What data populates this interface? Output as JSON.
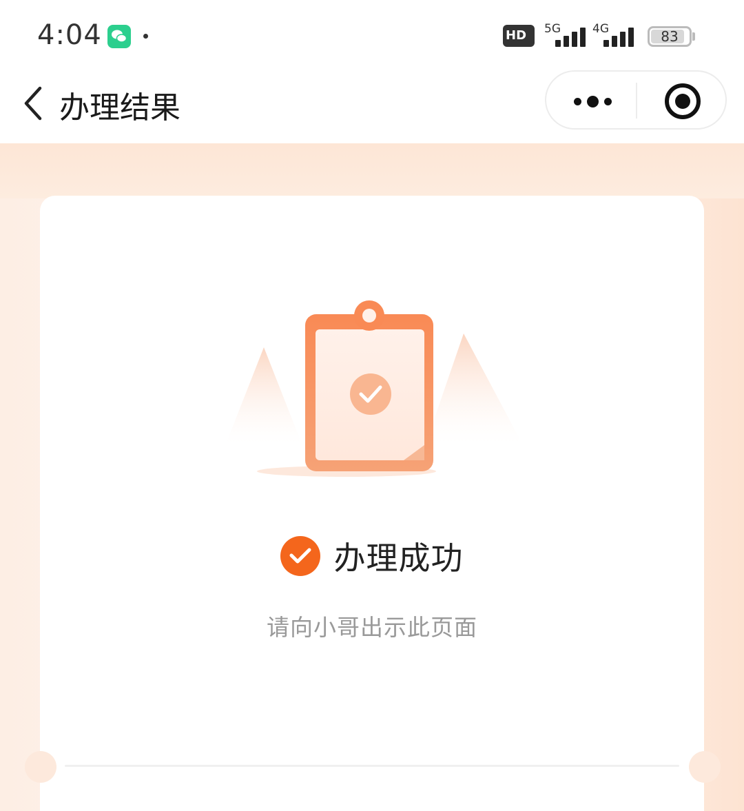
{
  "status_bar": {
    "time": "4:04",
    "hd": "HD",
    "net1": "5G",
    "net2": "4G",
    "battery": "83"
  },
  "nav": {
    "title": "办理结果"
  },
  "result": {
    "title": "办理成功",
    "subtitle": "请向小哥出示此页面"
  },
  "colors": {
    "accent": "#f4661c",
    "wechat": "#2ccf8e"
  },
  "icons": [
    "back-arrow-icon",
    "more-dots-icon",
    "close-target-icon",
    "check-circle-icon",
    "clipboard-illustration",
    "wechat-icon"
  ]
}
